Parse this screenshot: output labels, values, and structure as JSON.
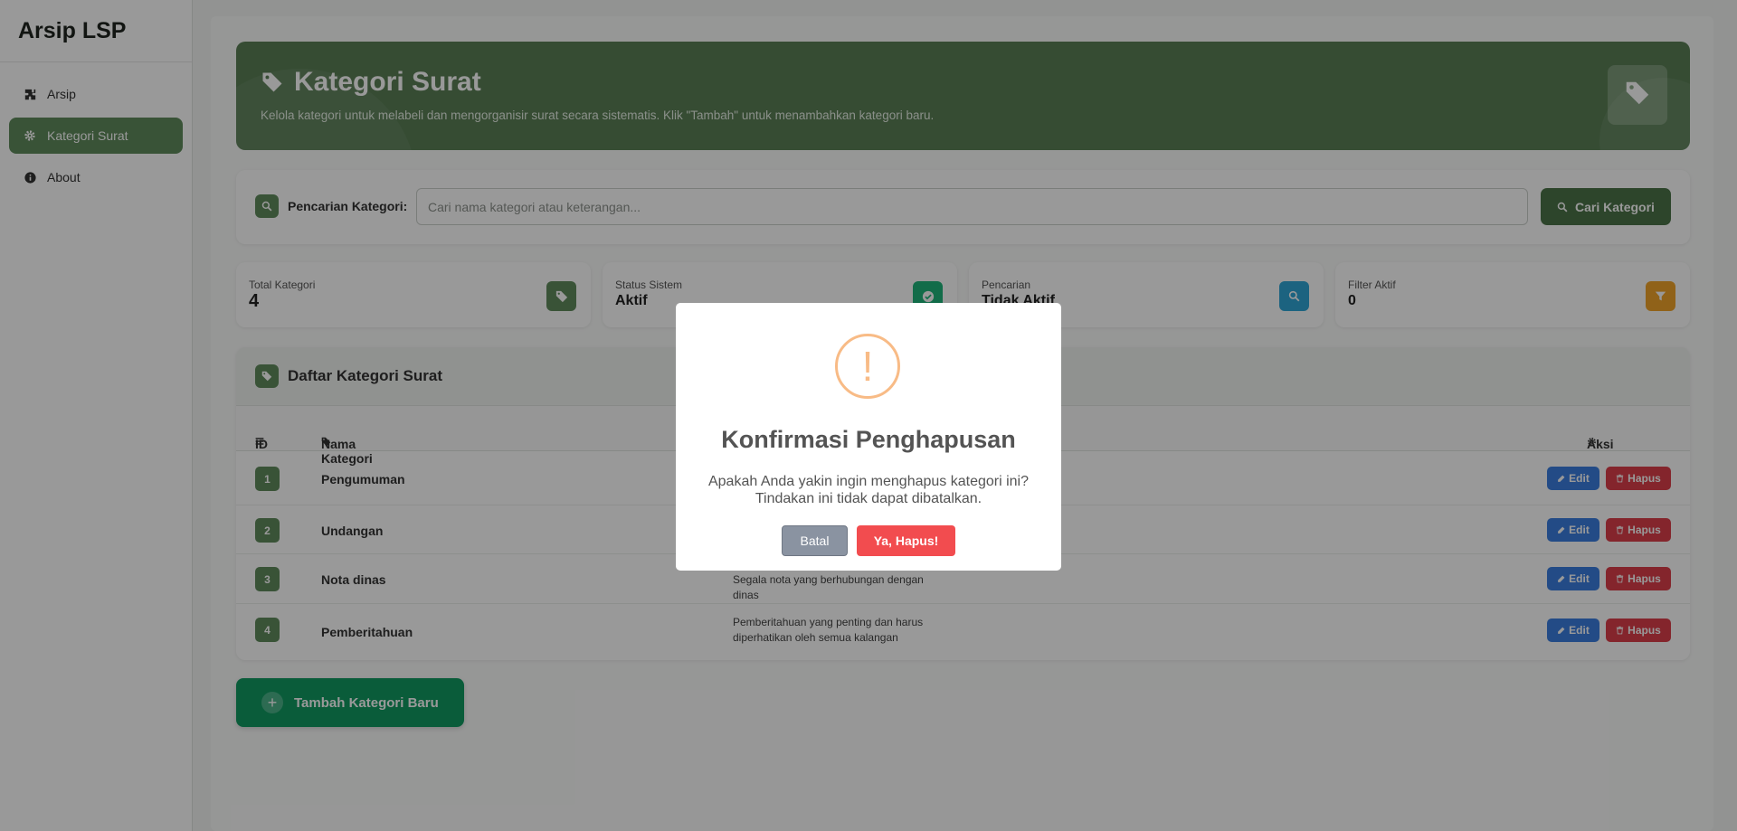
{
  "app": {
    "brand": "Arsip LSP"
  },
  "sidebar": {
    "items": [
      {
        "label": "Arsip",
        "icon": "puzzle-icon",
        "active": false
      },
      {
        "label": "Kategori Surat",
        "icon": "gear-icon",
        "active": true
      },
      {
        "label": "About",
        "icon": "info-icon",
        "active": false
      }
    ]
  },
  "hero": {
    "title": "Kategori Surat",
    "subtitle": "Kelola kategori untuk melabeli dan mengorganisir surat secara sistematis. Klik \"Tambah\" untuk menambahkan kategori baru."
  },
  "search": {
    "label": "Pencarian Kategori:",
    "placeholder": "Cari nama kategori atau keterangan...",
    "value": "",
    "button": "Cari Kategori"
  },
  "stats": [
    {
      "label": "Total Kategori",
      "value": "4",
      "icon": "tag-icon",
      "color": "#5f8a5c"
    },
    {
      "label": "Status Sistem",
      "value": "Aktif",
      "icon": "check-circle-icon",
      "color": "#1fb57a"
    },
    {
      "label": "Pencarian",
      "value": "Tidak Aktif",
      "icon": "search-icon",
      "color": "#2fa6d6"
    },
    {
      "label": "Filter Aktif",
      "value": "0",
      "icon": "filter-icon",
      "color": "#f0a42b"
    }
  ],
  "table": {
    "title": "Daftar Kategori Surat",
    "headers": {
      "id": "ID",
      "name": "Nama Kategori",
      "actions": "Aksi"
    },
    "rows": [
      {
        "id": "1",
        "name": "Pengumuman",
        "desc": ""
      },
      {
        "id": "2",
        "name": "Undangan",
        "desc": ""
      },
      {
        "id": "3",
        "name": "Nota dinas",
        "desc": "Segala nota yang berhubungan dengan dinas"
      },
      {
        "id": "4",
        "name": "Pemberitahuan",
        "desc": "Pemberitahuan yang penting dan harus diperhatikan oleh semua kalangan"
      }
    ],
    "edit_label": "Edit",
    "delete_label": "Hapus"
  },
  "add_button": "Tambah Kategori Baru",
  "modal": {
    "icon": "!",
    "title": "Konfirmasi Penghapusan",
    "text": "Apakah Anda yakin ingin menghapus kategori ini? Tindakan ini tidak dapat dibatalkan.",
    "cancel": "Batal",
    "confirm": "Ya, Hapus!"
  },
  "colors": {
    "primary": "#5f8a5c",
    "edit": "#3b7de0",
    "delete": "#dc3f4a",
    "add": "#119a62",
    "warning": "#f8bb86"
  }
}
